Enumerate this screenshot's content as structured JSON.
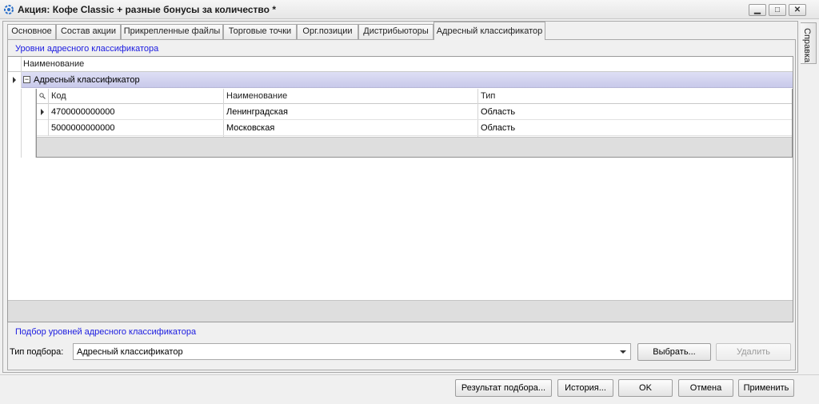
{
  "window": {
    "title": "Акция: Кофе Classic + разные бонусы за количество *",
    "minimize_label": "▁",
    "maximize_label": "□",
    "close_label": "✕"
  },
  "side_panel": {
    "help_label": "Справка"
  },
  "tabs": [
    {
      "label": "Основное"
    },
    {
      "label": "Состав акции"
    },
    {
      "label": "Прикрепленные файлы"
    },
    {
      "label": "Торговые точки"
    },
    {
      "label": "Орг.позиции"
    },
    {
      "label": "Дистрибьюторы"
    },
    {
      "label": "Адресный классификатор",
      "active": true
    }
  ],
  "levels_section": {
    "title": "Уровни адресного классификатора",
    "header": {
      "name": "Наименование"
    },
    "group": {
      "expander": "−",
      "label": "Адресный классификатор"
    },
    "detail": {
      "columns": {
        "code": "Код",
        "name": "Наименование",
        "type": "Тип"
      },
      "rows": [
        {
          "code": "4700000000000",
          "name": "Ленинградская",
          "type": "Область"
        },
        {
          "code": "5000000000000",
          "name": "Московская",
          "type": "Область"
        }
      ]
    }
  },
  "picker_section": {
    "title": "Подбор уровней адресного классификатора",
    "type_label": "Тип подбора:",
    "type_value": "Адресный классификатор",
    "select_button": "Выбрать...",
    "delete_button": "Удалить"
  },
  "bottom_bar": {
    "result_button": "Результат подбора...",
    "history_button": "История...",
    "ok_button": "OK",
    "cancel_button": "Отмена",
    "apply_button": "Применить"
  }
}
